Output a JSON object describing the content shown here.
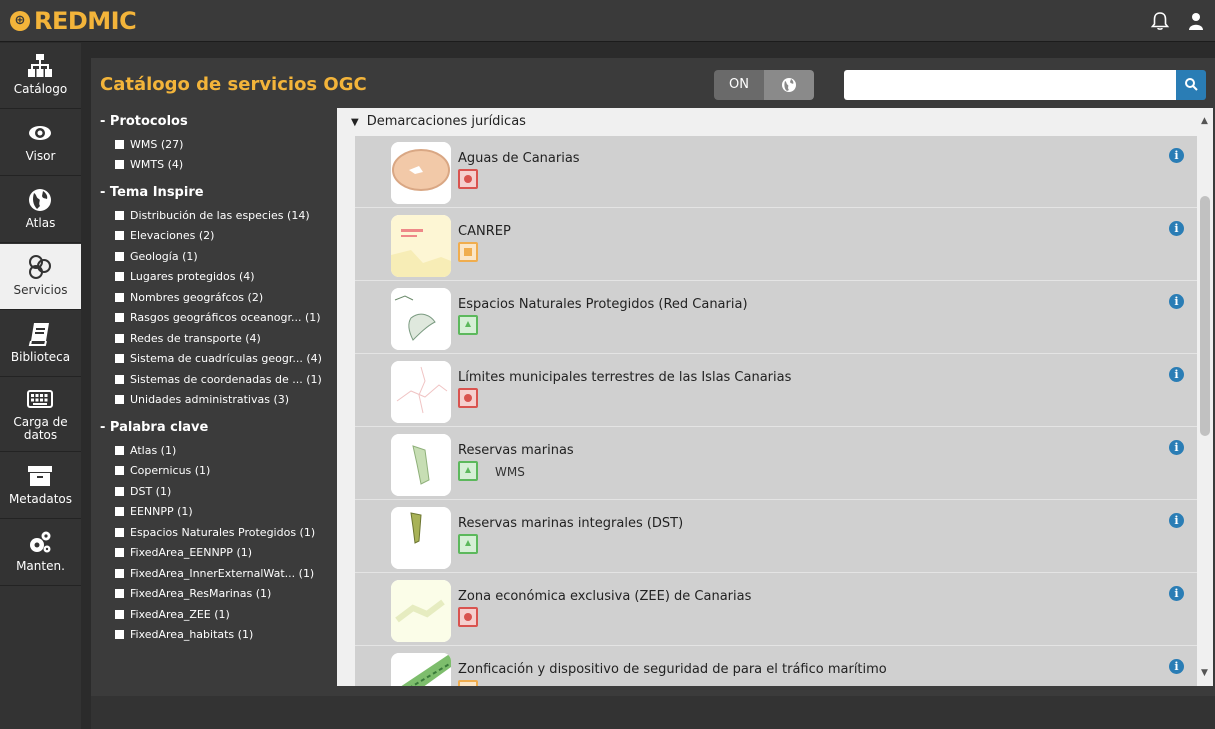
{
  "app": {
    "logo_text": "REDMIC"
  },
  "nav": {
    "items": [
      {
        "label": "Catálogo",
        "icon": "sitemap-icon"
      },
      {
        "label": "Visor",
        "icon": "eye-icon"
      },
      {
        "label": "Atlas",
        "icon": "globe-icon"
      },
      {
        "label": "Servicios",
        "icon": "ogc-services-icon",
        "active": true
      },
      {
        "label": "Biblioteca",
        "icon": "book-icon"
      },
      {
        "label": "Carga de datos",
        "icon": "keyboard-icon"
      },
      {
        "label": "Metadatos",
        "icon": "archive-icon"
      },
      {
        "label": "Manten.",
        "icon": "gears-icon"
      }
    ]
  },
  "header": {
    "title": "Catálogo de servicios OGC",
    "toggle_label": "ON",
    "search_placeholder": ""
  },
  "filters": {
    "protocolos": {
      "title": "- Protocolos",
      "items": [
        "WMS (27)",
        "WMTS (4)"
      ]
    },
    "tema": {
      "title": "- Tema Inspire",
      "items": [
        "Distribución de las especies (14)",
        "Elevaciones (2)",
        "Geología (1)",
        "Lugares protegidos (4)",
        "Nombres geográfcos (2)",
        "Rasgos geográficos oceanogr... (1)",
        "Redes de transporte (4)",
        "Sistema de cuadrículas geogr... (4)",
        "Sistemas de coordenadas de ... (1)",
        "Unidades administrativas (3)"
      ]
    },
    "palabra": {
      "title": "- Palabra clave",
      "items": [
        "Atlas (1)",
        "Copernicus (1)",
        "DST (1)",
        "EENNPP (1)",
        "Espacios Naturales Protegidos (1)",
        "FixedArea_EENNPP (1)",
        "FixedArea_InnerExternalWat... (1)",
        "FixedArea_ResMarinas (1)",
        "FixedArea_ZEE (1)",
        "FixedArea_habitats (1)"
      ]
    }
  },
  "results": {
    "group_title": "Demarcaciones jurídicas",
    "items": [
      {
        "title": "Aguas de Canarias",
        "badge": "red",
        "type": ""
      },
      {
        "title": "CANREP",
        "badge": "orange",
        "type": ""
      },
      {
        "title": "Espacios Naturales Protegidos (Red Canaria)",
        "badge": "green",
        "type": ""
      },
      {
        "title": "Límites municipales terrestres de las Islas Canarias",
        "badge": "red",
        "type": ""
      },
      {
        "title": "Reservas marinas",
        "badge": "green",
        "type": "WMS"
      },
      {
        "title": "Reservas marinas integrales (DST)",
        "badge": "green",
        "type": ""
      },
      {
        "title": "Zona económica exclusiva (ZEE) de Canarias",
        "badge": "red",
        "type": ""
      },
      {
        "title": "Zonficación y dispositivo de seguridad de para el tráfico marítimo",
        "badge": "orange",
        "type": ""
      }
    ]
  },
  "colors": {
    "accent": "#f3b43a",
    "link": "#2a7db5"
  }
}
